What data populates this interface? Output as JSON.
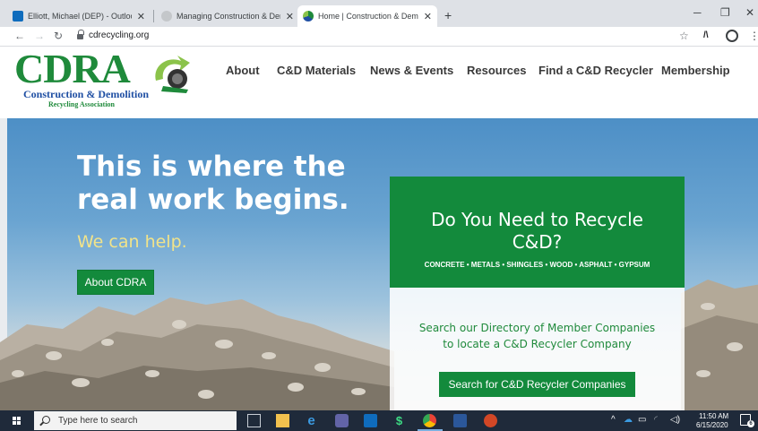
{
  "browser": {
    "tabs": [
      {
        "title": "Elliott, Michael (DEP) - Outlook W",
        "icon": "outlook-icon",
        "color": "#0f6cbd"
      },
      {
        "title": "Managing Construction & Demoli",
        "icon": "globe-icon",
        "color": "#9aa0a6"
      },
      {
        "title": "Home | Construction & Demolitio",
        "icon": "cdra-favicon-icon",
        "color": "#1f8a3b"
      }
    ],
    "new_tab_label": "+",
    "url": "cdrecycling.org"
  },
  "site": {
    "logo": {
      "big": "CDRA",
      "line1": "Construction & Demolition",
      "line2": "Recycling Association"
    },
    "nav": [
      "About",
      "C&D Materials",
      "News & Events",
      "Resources",
      "Find a C&D Recycler",
      "Membership"
    ]
  },
  "hero": {
    "headline": [
      "This is where the",
      "real work begins."
    ],
    "help": "We can help.",
    "about_button": "About CDRA",
    "card": {
      "title": [
        "Do You Need to Recycle",
        "C&D?"
      ],
      "materials": "CONCRETE • METALS • SHINGLES • WOOD • ASPHALT • GYPSUM",
      "text": [
        "Search our Directory of Member Companies",
        "to locate a C&D Recycler Company"
      ],
      "button": "Search for C&D Recycler Companies"
    }
  },
  "taskbar": {
    "search_placeholder": "Type here to search",
    "time": "11:50 AM",
    "date": "6/15/2020",
    "notification_count": "6"
  },
  "colors": {
    "brand_green": "#138a3c",
    "headline_yellow": "#f1e38a",
    "nav_text": "#3a3a3a",
    "taskbar": "#1f2a3a"
  }
}
